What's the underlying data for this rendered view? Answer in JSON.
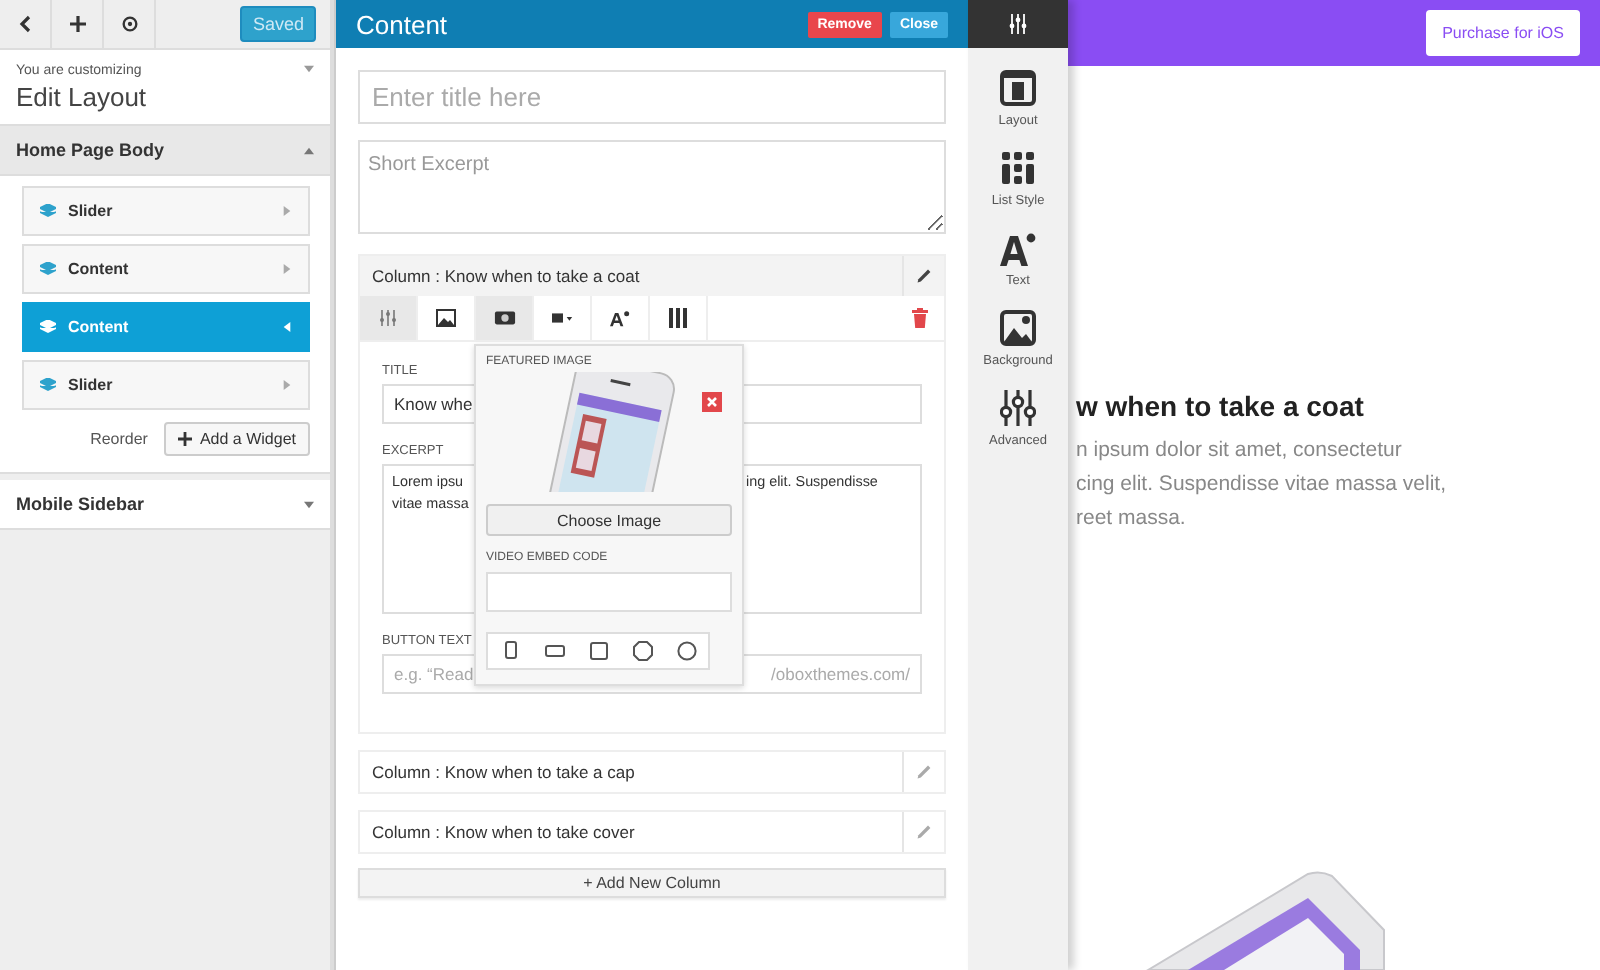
{
  "sidebar": {
    "toolbar": [
      {
        "kind": "back"
      },
      {
        "kind": "add"
      },
      {
        "kind": "preview"
      }
    ],
    "saved_button": "Saved",
    "customizing_label": "You are customizing",
    "customizing_title": "Edit Layout",
    "sections": [
      {
        "title": "Home Page Body",
        "expanded": true,
        "widgets": [
          {
            "label": "Slider",
            "selected": false
          },
          {
            "label": "Content",
            "selected": false
          },
          {
            "label": "Content",
            "selected": true
          },
          {
            "label": "Slider",
            "selected": false
          }
        ],
        "reorder": "Reorder",
        "add_widget": "Add a Widget"
      },
      {
        "title": "Mobile Sidebar",
        "expanded": false
      }
    ]
  },
  "editor": {
    "title": "Content",
    "remove_button": "Remove",
    "close_button": "Close",
    "title_field": {
      "placeholder": "Enter title here"
    },
    "excerpt_field": {
      "placeholder": "Short Excerpt"
    },
    "columns": [
      {
        "title": "Column : Know when to take a coat",
        "expanded": true
      },
      {
        "title": "Column : Know when to take a cap",
        "expanded": false
      },
      {
        "title": "Column : Know when to take cover",
        "expanded": false
      }
    ],
    "column_tabs": [
      {
        "kind": "settings",
        "selected": true
      },
      {
        "kind": "image",
        "selected": false
      },
      {
        "kind": "media",
        "selected": true
      },
      {
        "kind": "button",
        "selected": false
      },
      {
        "kind": "text",
        "selected": false
      },
      {
        "kind": "columns",
        "selected": false
      }
    ],
    "fields": {
      "title_label": "TITLE",
      "title_value": "Know whe",
      "excerpt_label": "EXCERPT",
      "excerpt_lines": [
        {
          "left": "Lorem ipsu",
          "right": "ing elit. Suspendisse"
        },
        {
          "left": "vitae massa"
        }
      ],
      "button_label": "BUTTON TEXT",
      "button_placeholder_left": "e.g. “Read",
      "button_placeholder_right": "/oboxthemes.com/"
    },
    "popover": {
      "featured_label": "FEATURED IMAGE",
      "choose_button": "Choose Image",
      "video_label": "VIDEO EMBED CODE",
      "shapes": [
        {
          "kind": "portrait"
        },
        {
          "kind": "landscape"
        },
        {
          "kind": "square"
        },
        {
          "kind": "octagon"
        },
        {
          "kind": "circle"
        }
      ]
    },
    "add_column": "+ Add New Column"
  },
  "iconbar": {
    "items": [
      {
        "kind": "layout",
        "label": "Layout"
      },
      {
        "kind": "list",
        "label": "List Style"
      },
      {
        "kind": "text",
        "label": "Text"
      },
      {
        "kind": "background",
        "label": "Background"
      },
      {
        "kind": "advanced",
        "label": "Advanced"
      }
    ]
  },
  "preview": {
    "button": "Purchase for iOS",
    "heading": "w when to take a coat",
    "lines": [
      "n ipsum dolor sit amet, consectetur",
      "cing elit. Suspendisse vitae massa velit,",
      "reet massa."
    ]
  }
}
